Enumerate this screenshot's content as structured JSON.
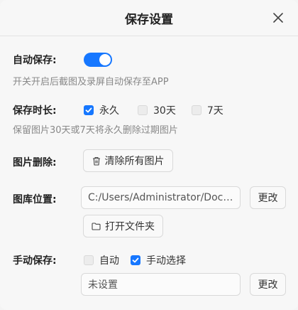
{
  "dialog": {
    "title": "保存设置"
  },
  "auto_save": {
    "label": "自动保存:",
    "enabled": true,
    "desc": "开关开启后截图及录屏自动保存至APP"
  },
  "retention": {
    "label": "保存时长:",
    "options": [
      {
        "label": "永久",
        "checked": true
      },
      {
        "label": "30天",
        "checked": false
      },
      {
        "label": "7天",
        "checked": false
      }
    ],
    "desc": "保留图片30天或7天将永久删除过期图片"
  },
  "delete": {
    "label": "图片删除:",
    "button": "清除所有图片"
  },
  "gallery": {
    "label": "图库位置:",
    "path": "C:/Users/Administrator/Documents/",
    "change": "更改",
    "open_folder": "打开文件夹"
  },
  "manual_save": {
    "label": "手动保存:",
    "options": [
      {
        "label": "自动",
        "checked": false
      },
      {
        "label": "手动选择",
        "checked": true
      }
    ],
    "path": "未设置",
    "change": "更改"
  },
  "colors": {
    "accent": "#1677ff"
  }
}
